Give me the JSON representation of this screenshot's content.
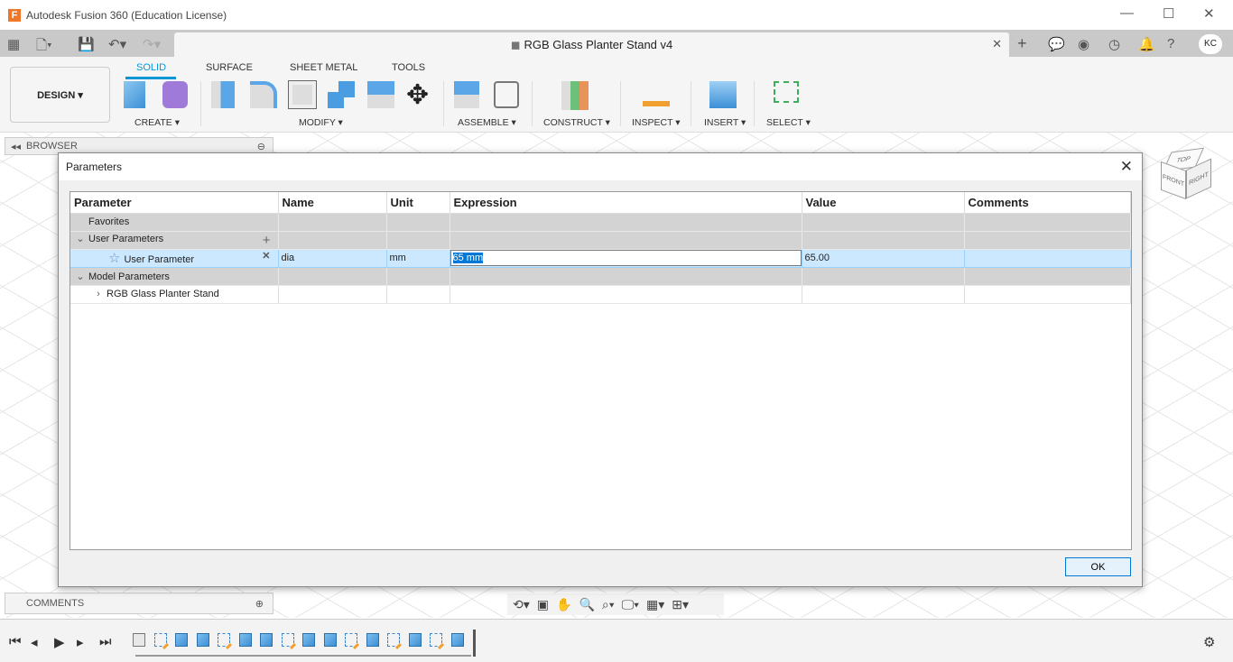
{
  "window": {
    "title": "Autodesk Fusion 360 (Education License)",
    "app_icon_letter": "F"
  },
  "document_tab": {
    "title": "RGB Glass Planter Stand v4"
  },
  "user": {
    "initials": "KC"
  },
  "ribbon": {
    "workspace": "DESIGN ▾",
    "tabs": [
      {
        "label": "SOLID",
        "active": true
      },
      {
        "label": "SURFACE"
      },
      {
        "label": "SHEET METAL"
      },
      {
        "label": "TOOLS"
      }
    ],
    "groups": [
      "CREATE ▾",
      "MODIFY ▾",
      "ASSEMBLE ▾",
      "CONSTRUCT ▾",
      "INSPECT ▾",
      "INSERT ▾",
      "SELECT ▾"
    ]
  },
  "browser": {
    "label": "BROWSER"
  },
  "comments": {
    "label": "COMMENTS"
  },
  "dialog": {
    "title": "Parameters",
    "columns": [
      "Parameter",
      "Name",
      "Unit",
      "Expression",
      "Value",
      "Comments"
    ],
    "rows": [
      {
        "type": "group",
        "parameter": "Favorites"
      },
      {
        "type": "group",
        "parameter": "User Parameters",
        "expanded": true
      },
      {
        "type": "param",
        "parameter": "User Parameter",
        "name": "dia",
        "unit": "mm",
        "expression": "65 mm",
        "value": "65.00",
        "comments": "",
        "selected": true
      },
      {
        "type": "group",
        "parameter": "Model Parameters",
        "expanded": true
      },
      {
        "type": "item",
        "parameter": "RGB Glass Planter Stand",
        "expanded": false
      }
    ],
    "ok_label": "OK"
  },
  "viewcube": {
    "top": "TOP",
    "front": "FRONT",
    "right": "RIGHT"
  },
  "timeline": {
    "features": [
      "body",
      "sketch",
      "extrude",
      "extrude",
      "sketch",
      "extrude",
      "extrude",
      "sketch",
      "extrude",
      "extrude",
      "sketch",
      "extrude",
      "sketch",
      "extrude",
      "sketch",
      "extrude"
    ]
  },
  "colors": {
    "accent": "#0696d7",
    "selection": "#cce8ff",
    "highlight": "#0078d7"
  }
}
